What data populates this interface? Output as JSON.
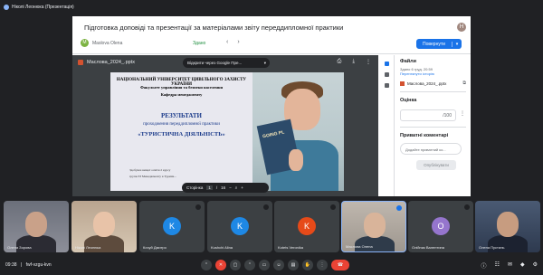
{
  "presenter": {
    "label": "Ніколі Леонюка (Презентація)"
  },
  "classroom": {
    "title": "Підготовка доповіді та презентації за матеріалами звіту переддипломної практики",
    "header_avatar": "Н",
    "user_initial": "M",
    "user_name": "Maslova Olena",
    "status": "Здано",
    "nav_prev": "‹",
    "nav_next": "›",
    "return_label": "Повернути",
    "return_arrow": "▾"
  },
  "viewer": {
    "file_name": "Маслова_2024_.pptx",
    "open_with": "Відкрити через Google Пре...",
    "open_chevron": "▾",
    "tools": [
      "⎙",
      "⤓",
      "⋮"
    ],
    "page_label": "Сторінка",
    "page_current": "1",
    "page_sep": "/",
    "page_total": "16",
    "zoom_out": "−",
    "zoom_in": "+",
    "zoom_icon": "⌕"
  },
  "slide": {
    "line1": "НАЦІОНАЛЬНИЙ УНІВЕРСИТЕТ ЦИВІЛЬНОГО ЗАХИСТУ УКРАЇНИ",
    "line2": "Факультет управління та безпеки населення",
    "line3": "Кафедра менеджменту",
    "line4": "РЕЗУЛЬТАТИ",
    "line5": "проходження переддипломної практики",
    "line6": "«ТУРИСТИЧНА ДІЯЛЬНІСТЬ»",
    "student1": "Здобувач вищої освіти 2 курсу",
    "student2": "групи ЗЗ Менеджменту в Туризм...",
    "book_text": "GOING PL"
  },
  "side_panel": {
    "files_title": "Файли",
    "submitted_line1": "Здано 6 груд. 20:59",
    "history_link": "Переглянути історію",
    "file_name": "Маслова_2024_.pptx",
    "file_open_icon": "⧉",
    "grade_title": "Оцінка",
    "grade_value": "/100",
    "grade_menu": "⋮",
    "comments_title": "Приватні коментарі",
    "comment_placeholder": "Додайте приватний ко...",
    "publish_label": "Опублікувати"
  },
  "participants": [
    {
      "name": "Олена Зорова",
      "kind": "photo1"
    },
    {
      "name": "Ніколі Леонюка",
      "kind": "photo2"
    },
    {
      "name": "Кочуй Дмитро",
      "kind": "avatar",
      "initial": "K",
      "color": "#1e88e5"
    },
    {
      "name": "Kushchi Alina",
      "kind": "avatar",
      "initial": "K",
      "color": "#1e88e5"
    },
    {
      "name": "Kotets Veronika",
      "kind": "avatar",
      "initial": "K",
      "color": "#e64a19"
    },
    {
      "name": "Маслова Олена",
      "kind": "photo3"
    },
    {
      "name": "Олійник Валентина",
      "kind": "avatar",
      "initial": "O",
      "color": "#9575cd"
    },
    {
      "name": "Олена Пустиль",
      "kind": "photo4"
    }
  ],
  "bottom_bar": {
    "time": "09:38",
    "meeting_code": "fwf-vzgu-kvn",
    "controls": [
      "⌃",
      "✕",
      "▢",
      "⌃",
      "▭",
      "☺",
      "▤",
      "✋",
      "⋮"
    ],
    "end_icon": "☎",
    "right_icons": [
      "ⓘ",
      "☷",
      "✉",
      "◆",
      "⚙"
    ]
  },
  "colors": {
    "accent": "#1a73e8",
    "danger": "#ea4335",
    "meet_bg": "#202124",
    "tile_bg": "#3c4043"
  }
}
